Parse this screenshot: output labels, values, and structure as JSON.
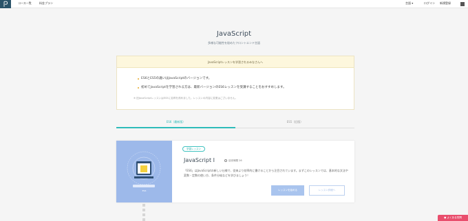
{
  "header": {
    "nav": [
      "コース一覧",
      "料金プラン"
    ],
    "lang": "言語 ▾",
    "login": "ログイン",
    "signup": "新規登録"
  },
  "page": {
    "title": "JavaScript",
    "subtitle": "多様な可能性を秘めたフロントエンド言語"
  },
  "notice": {
    "heading": "JavaScriptレッスンを学習されるみなさんへ",
    "items": [
      "ES6とES5の違いはJavaScriptのバージョンです。",
      "初めてJavaScriptを学習される方は、最新バージョンのES6レッスンを受講することをおすすめします。"
    ],
    "note": "※ 旧JavaScriptレッスンはES5に名称を改めました。レッスンの内容に変更はございません。"
  },
  "tabs": [
    {
      "label": "ES6（最新版）",
      "active": true
    },
    {
      "label": "ES5（旧版）",
      "active": false
    }
  ],
  "lesson": {
    "badge": "学習レッスン",
    "title": "JavaScript I",
    "duration": "目安時間 26",
    "description": "「ES6」はJavaScriptの新しい仕様で、従来より効率的に書けることから注目されています。まずこのレッスンでは、基本的な文法や変数・定数の使い方、条件分岐などを学びましょう！",
    "visual_label": "ES6",
    "start_button": "レッスンを始める",
    "details_button": "レッスン詳細へ"
  },
  "help_button": "よくある質問",
  "colors": {
    "accent": "#2dbbb9",
    "brand": "#2b546a",
    "card_visual": "#9db9ea",
    "help": "#e94e6d"
  }
}
